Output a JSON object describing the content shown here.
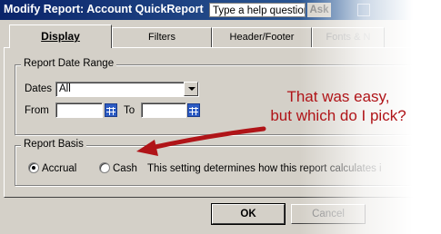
{
  "window": {
    "title": "Modify Report: Account QuickReport",
    "help_value": "Type a help question",
    "ask_label": "Ask"
  },
  "tabs": [
    {
      "label": "Display",
      "active": true
    },
    {
      "label": "Filters",
      "active": false
    },
    {
      "label": "Header/Footer",
      "active": false
    },
    {
      "label": "Fonts & N",
      "active": false
    }
  ],
  "date_range": {
    "legend": "Report Date Range",
    "dates_label": "Dates",
    "dates_value": "All",
    "from_label": "From",
    "from_value": "",
    "to_label": "To",
    "to_value": ""
  },
  "report_basis": {
    "legend": "Report Basis",
    "options": [
      {
        "label": "Accrual",
        "selected": true
      },
      {
        "label": "Cash",
        "selected": false
      }
    ],
    "description": "This setting determines how this report calculates i"
  },
  "buttons": {
    "ok": "OK",
    "cancel": "Cancel"
  },
  "annotation": {
    "line1": "That was easy,",
    "line2": "but which do I pick?",
    "color": "#b01418"
  },
  "colors": {
    "face": "#d4d0c8",
    "titlebar_start": "#0a246a",
    "titlebar_end": "#3a6ea5"
  }
}
